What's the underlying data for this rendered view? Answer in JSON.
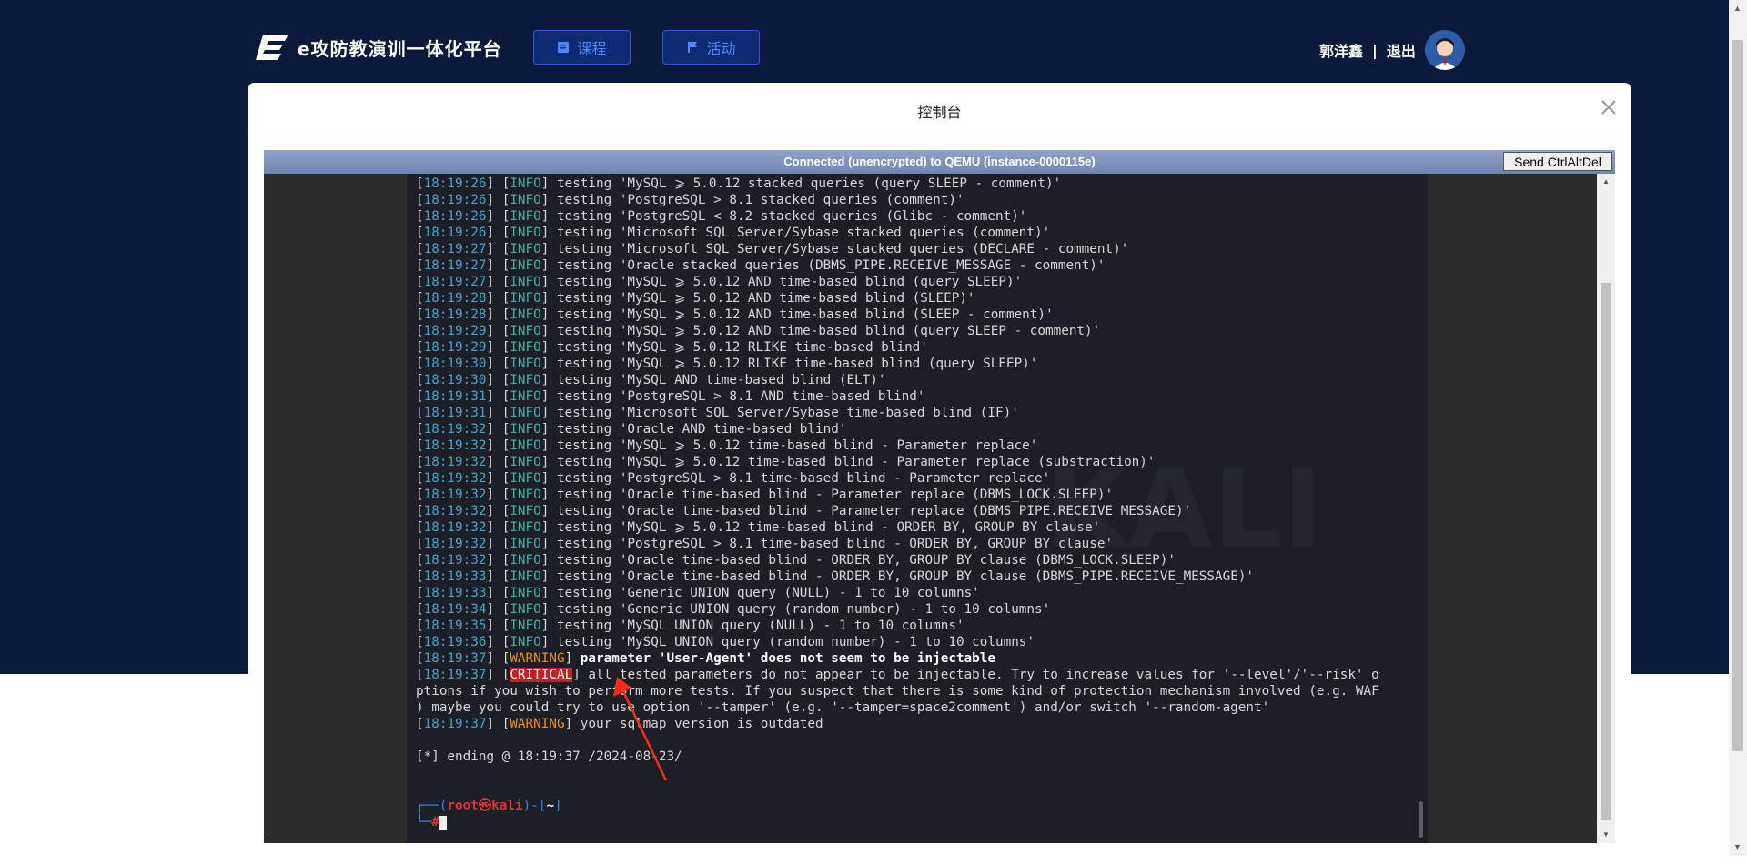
{
  "brand": {
    "name": "e攻防教演训一体化平台"
  },
  "nav": {
    "course": "课程",
    "activity": "活动"
  },
  "user": {
    "name": "郭洋鑫",
    "separator": "|",
    "logout": "退出"
  },
  "modal": {
    "title": "控制台",
    "close": "×"
  },
  "vnc": {
    "status": "Connected (unencrypted) to QEMU (instance-0000115e)",
    "cad_button": "Send CtrlAltDel"
  },
  "terminal": {
    "watermark": "KALI",
    "log": [
      {
        "time": "18:19:26",
        "level": "INFO",
        "text": " testing 'MySQL ⩾ 5.0.12 stacked queries (query SLEEP - comment)'"
      },
      {
        "time": "18:19:26",
        "level": "INFO",
        "text": " testing 'PostgreSQL > 8.1 stacked queries (comment)'"
      },
      {
        "time": "18:19:26",
        "level": "INFO",
        "text": " testing 'PostgreSQL < 8.2 stacked queries (Glibc - comment)'"
      },
      {
        "time": "18:19:26",
        "level": "INFO",
        "text": " testing 'Microsoft SQL Server/Sybase stacked queries (comment)'"
      },
      {
        "time": "18:19:27",
        "level": "INFO",
        "text": " testing 'Microsoft SQL Server/Sybase stacked queries (DECLARE - comment)'"
      },
      {
        "time": "18:19:27",
        "level": "INFO",
        "text": " testing 'Oracle stacked queries (DBMS_PIPE.RECEIVE_MESSAGE - comment)'"
      },
      {
        "time": "18:19:27",
        "level": "INFO",
        "text": " testing 'MySQL ⩾ 5.0.12 AND time-based blind (query SLEEP)'"
      },
      {
        "time": "18:19:28",
        "level": "INFO",
        "text": " testing 'MySQL ⩾ 5.0.12 AND time-based blind (SLEEP)'"
      },
      {
        "time": "18:19:28",
        "level": "INFO",
        "text": " testing 'MySQL ⩾ 5.0.12 AND time-based blind (SLEEP - comment)'"
      },
      {
        "time": "18:19:29",
        "level": "INFO",
        "text": " testing 'MySQL ⩾ 5.0.12 AND time-based blind (query SLEEP - comment)'"
      },
      {
        "time": "18:19:29",
        "level": "INFO",
        "text": " testing 'MySQL ⩾ 5.0.12 RLIKE time-based blind'"
      },
      {
        "time": "18:19:30",
        "level": "INFO",
        "text": " testing 'MySQL ⩾ 5.0.12 RLIKE time-based blind (query SLEEP)'"
      },
      {
        "time": "18:19:30",
        "level": "INFO",
        "text": " testing 'MySQL AND time-based blind (ELT)'"
      },
      {
        "time": "18:19:31",
        "level": "INFO",
        "text": " testing 'PostgreSQL > 8.1 AND time-based blind'"
      },
      {
        "time": "18:19:31",
        "level": "INFO",
        "text": " testing 'Microsoft SQL Server/Sybase time-based blind (IF)'"
      },
      {
        "time": "18:19:32",
        "level": "INFO",
        "text": " testing 'Oracle AND time-based blind'"
      },
      {
        "time": "18:19:32",
        "level": "INFO",
        "text": " testing 'MySQL ⩾ 5.0.12 time-based blind - Parameter replace'"
      },
      {
        "time": "18:19:32",
        "level": "INFO",
        "text": " testing 'MySQL ⩾ 5.0.12 time-based blind - Parameter replace (substraction)'"
      },
      {
        "time": "18:19:32",
        "level": "INFO",
        "text": " testing 'PostgreSQL > 8.1 time-based blind - Parameter replace'"
      },
      {
        "time": "18:19:32",
        "level": "INFO",
        "text": " testing 'Oracle time-based blind - Parameter replace (DBMS_LOCK.SLEEP)'"
      },
      {
        "time": "18:19:32",
        "level": "INFO",
        "text": " testing 'Oracle time-based blind - Parameter replace (DBMS_PIPE.RECEIVE_MESSAGE)'"
      },
      {
        "time": "18:19:32",
        "level": "INFO",
        "text": " testing 'MySQL ⩾ 5.0.12 time-based blind - ORDER BY, GROUP BY clause'"
      },
      {
        "time": "18:19:32",
        "level": "INFO",
        "text": " testing 'PostgreSQL > 8.1 time-based blind - ORDER BY, GROUP BY clause'"
      },
      {
        "time": "18:19:32",
        "level": "INFO",
        "text": " testing 'Oracle time-based blind - ORDER BY, GROUP BY clause (DBMS_LOCK.SLEEP)'"
      },
      {
        "time": "18:19:33",
        "level": "INFO",
        "text": " testing 'Oracle time-based blind - ORDER BY, GROUP BY clause (DBMS_PIPE.RECEIVE_MESSAGE)'"
      },
      {
        "time": "18:19:33",
        "level": "INFO",
        "text": " testing 'Generic UNION query (NULL) - 1 to 10 columns'"
      },
      {
        "time": "18:19:34",
        "level": "INFO",
        "text": " testing 'Generic UNION query (random number) - 1 to 10 columns'"
      },
      {
        "time": "18:19:35",
        "level": "INFO",
        "text": " testing 'MySQL UNION query (NULL) - 1 to 10 columns'"
      },
      {
        "time": "18:19:36",
        "level": "INFO",
        "text": " testing 'MySQL UNION query (random number) - 1 to 10 columns'"
      }
    ],
    "warning1": {
      "time": "18:19:37",
      "level": "WARNING",
      "text": " parameter 'User-Agent' does not seem to be injectable"
    },
    "critical": {
      "time": "18:19:37",
      "level": "CRITICAL",
      "line1": " all tested parameters do not appear to be injectable. Try to increase values for '--level'/'--risk' o",
      "line2": "ptions if you wish to perform more tests. If you suspect that there is some kind of protection mechanism involved (e.g. WAF",
      "line3": ") maybe you could try to use option '--tamper' (e.g. '--tamper=space2comment') and/or switch '--random-agent'"
    },
    "warning2": {
      "time": "18:19:37",
      "level": "WARNING",
      "text": " your sqlmap version is outdated"
    },
    "ending": "[*] ending @ 18:19:37 /2024-08-23/",
    "prompt": {
      "frame1": "┌──(",
      "user": "root㉿kali",
      "frame2": ")-[",
      "dir": "~",
      "frame3": "]",
      "frame4": "└─",
      "hash": "#"
    }
  },
  "colors": {
    "header_bg": "#0b1a3a",
    "nav_border": "#2f5bd8",
    "nav_text": "#4f86ff",
    "info": "#3fb0a5",
    "warning": "#f08c1c",
    "critical": "#c4201f"
  }
}
